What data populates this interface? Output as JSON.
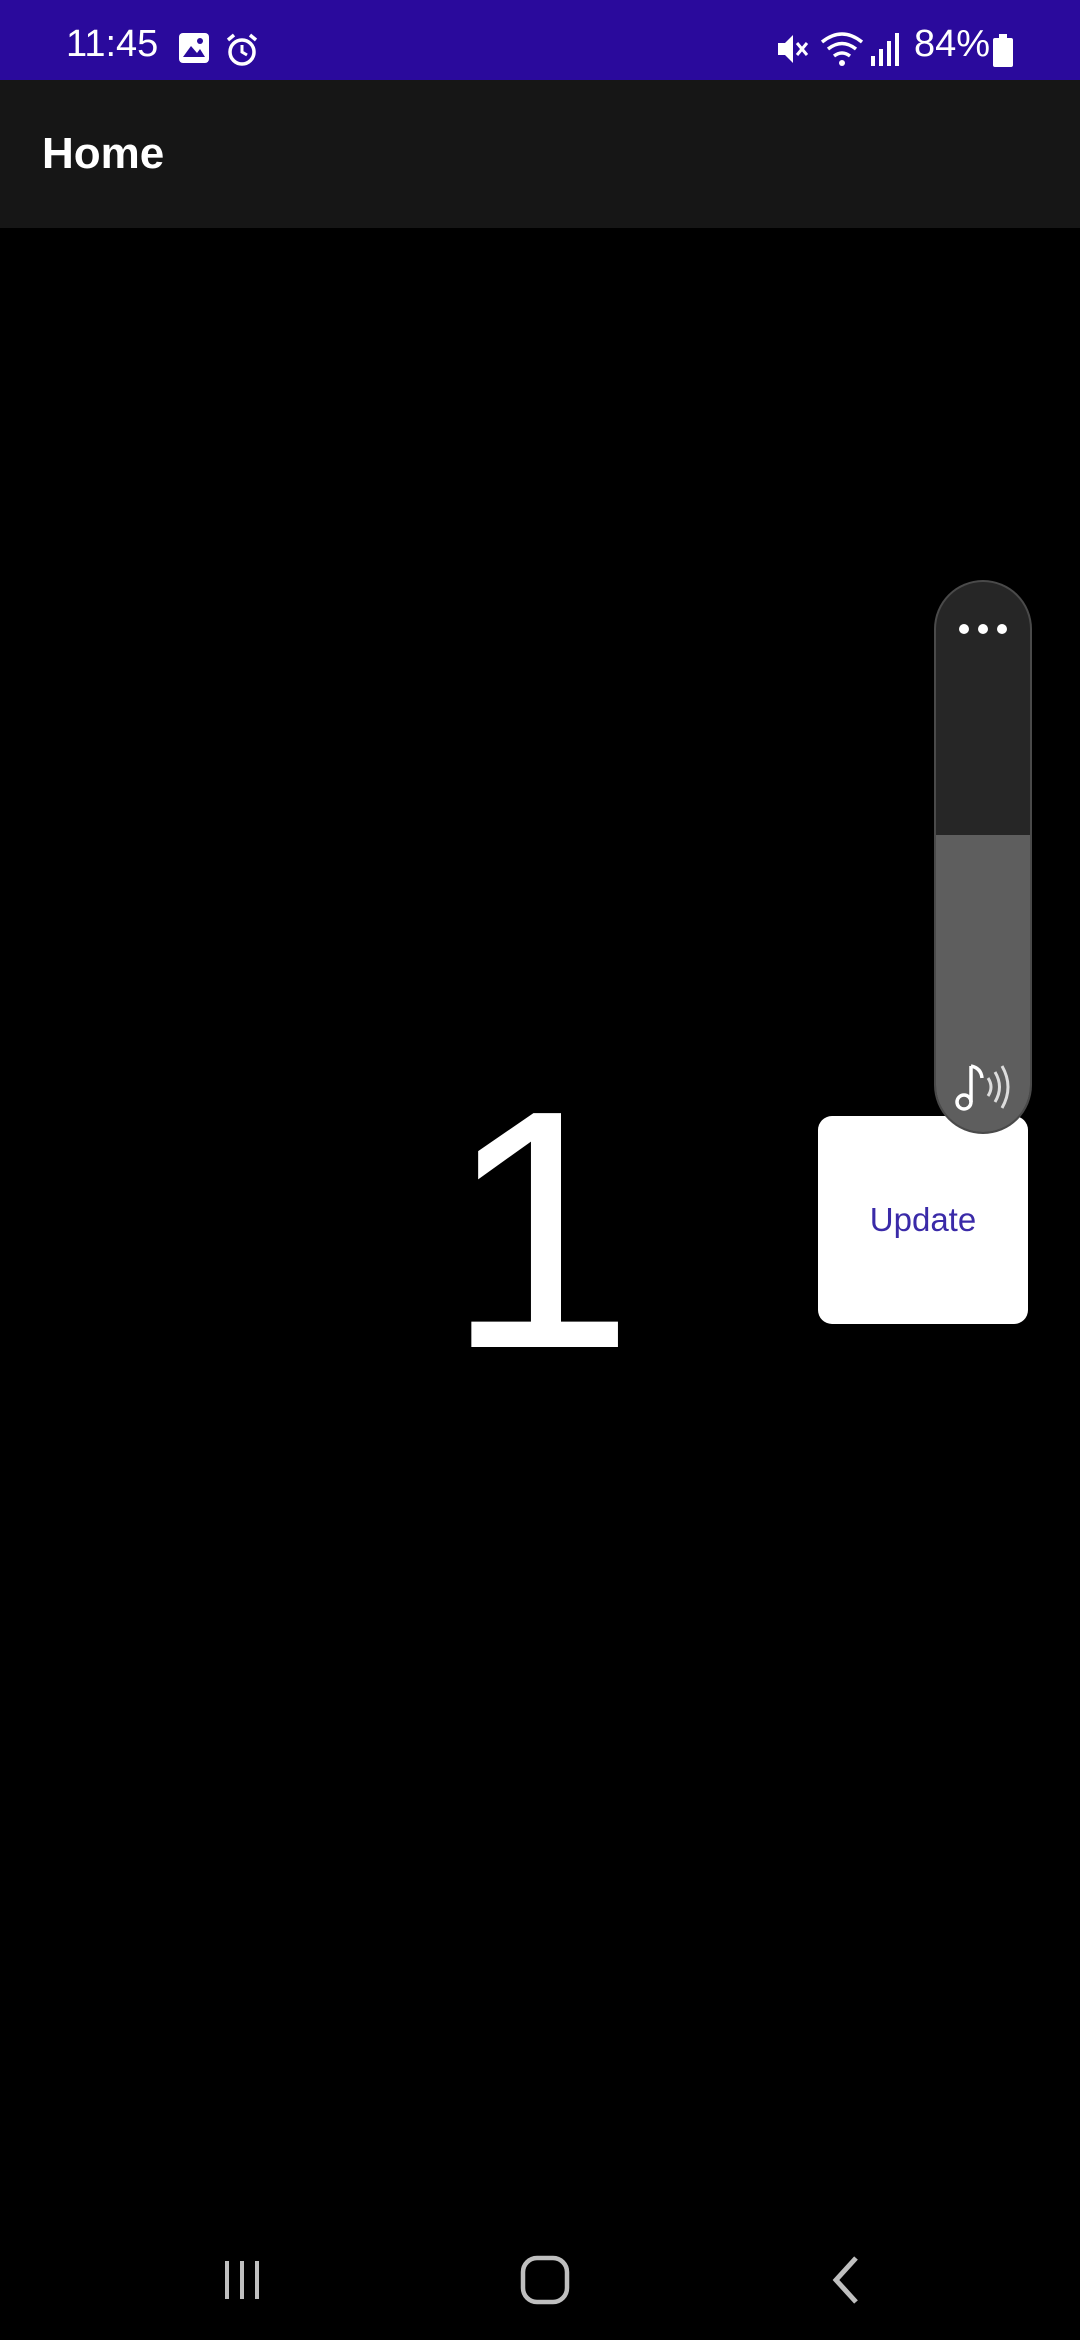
{
  "status_bar": {
    "time": "11:45",
    "battery": "84%",
    "background": "#2a0a9c",
    "icons": [
      "image-icon",
      "alarm-icon",
      "mute-icon",
      "wifi-icon",
      "signal-icon",
      "battery-icon"
    ]
  },
  "app_bar": {
    "title": "Home",
    "background": "#161616"
  },
  "main": {
    "counter": "1",
    "update_label": "Update",
    "update_label_color": "#3a2aa8"
  },
  "volume": {
    "level": 0.54,
    "icons": [
      "more-options-icon",
      "media-volume-icon"
    ]
  },
  "nav_bar": {
    "icons": [
      "recent-apps-icon",
      "home-icon",
      "back-icon"
    ]
  }
}
